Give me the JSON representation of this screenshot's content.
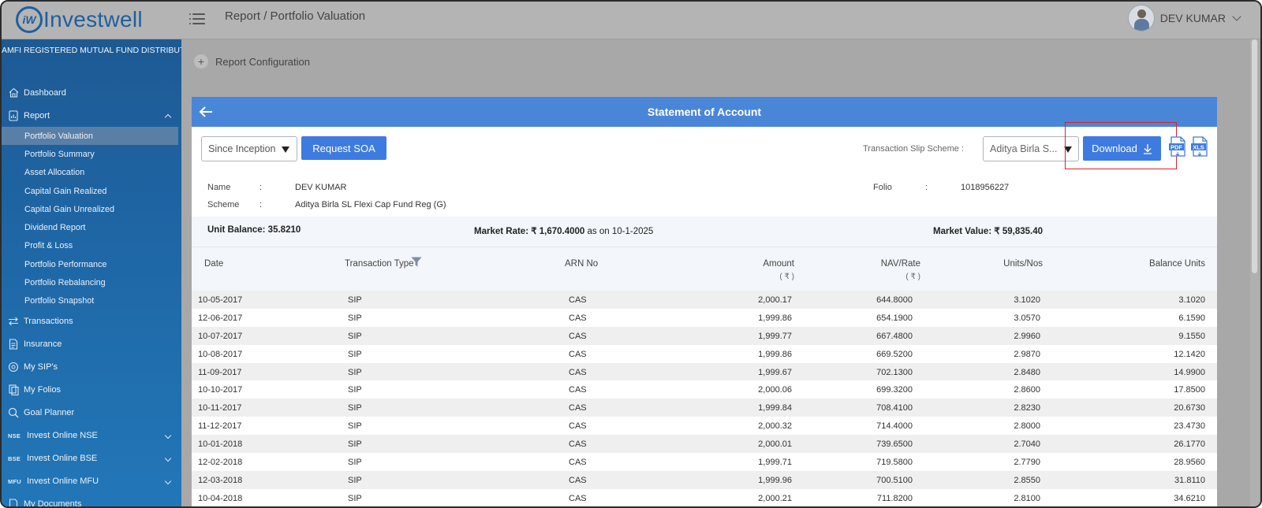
{
  "app": {
    "brand": "Investwell",
    "brand_mark": "iW"
  },
  "header": {
    "breadcrumb": "Report / Portfolio Valuation",
    "user_name": "DEV KUMAR"
  },
  "sidebar": {
    "tagline": "AMFI REGISTERED MUTUAL FUND DISTRIBUTOR",
    "items": [
      {
        "label": "Dashboard",
        "icon": "home-icon"
      },
      {
        "label": "Report",
        "icon": "report-icon",
        "expanded": true
      }
    ],
    "report_subitems": [
      "Portfolio Valuation",
      "Portfolio Summary",
      "Asset Allocation",
      "Capital Gain Realized",
      "Capital Gain Unrealized",
      "Dividend Report",
      "Profit & Loss",
      "Portfolio Performance",
      "Portfolio Rebalancing",
      "Portfolio Snapshot"
    ],
    "lower_items": [
      {
        "label": "Transactions",
        "icon": "transfer-icon"
      },
      {
        "label": "Insurance",
        "icon": "document-icon"
      },
      {
        "label": "My SIP's",
        "icon": "sip-icon"
      },
      {
        "label": "My Folios",
        "icon": "folio-icon"
      },
      {
        "label": "Goal Planner",
        "icon": "target-icon"
      },
      {
        "label": "Invest Online NSE",
        "tag": "NSE"
      },
      {
        "label": "Invest Online BSE",
        "tag": "BSE"
      },
      {
        "label": "Invest Online MFU",
        "tag": "MFU"
      },
      {
        "label": "My Documents",
        "icon": "documents-icon"
      }
    ],
    "active_item": "Portfolio Valuation"
  },
  "content": {
    "config_label": "Report Configuration"
  },
  "statement": {
    "title": "Statement of Account",
    "period_select": "Since Inception",
    "request_button": "Request SOA",
    "slip_label": "Transaction Slip Scheme :",
    "scheme_select": "Aditya Birla S...",
    "download_button": "Download",
    "pdf_label": "PDF",
    "xls_label": "XLS"
  },
  "investor": {
    "name_label": "Name",
    "name": "DEV KUMAR",
    "scheme_label": "Scheme",
    "scheme": "Aditya Birla SL Flexi Cap Fund Reg (G)",
    "folio_label": "Folio",
    "folio": "1018956227",
    "colon": ":",
    "unit_balance": "Unit Balance: 35.8210",
    "market_rate_label": "Market Rate:",
    "market_rate_value": "₹ 1,670.4000",
    "market_rate_suffix": "as on 10-1-2025",
    "market_value_label": "Market Value:",
    "market_value": "₹ 59,835.40"
  },
  "table": {
    "headers": [
      "Date",
      "Transaction Type",
      "ARN No",
      "Amount",
      "NAV/Rate",
      "Units/Nos",
      "Balance Units"
    ],
    "amount_unit": "( ₹ )",
    "nav_unit": "( ₹ )",
    "rows": [
      [
        "10-05-2017",
        "SIP",
        "CAS",
        "2,000.17",
        "644.8000",
        "3.1020",
        "3.1020"
      ],
      [
        "12-06-2017",
        "SIP",
        "CAS",
        "1,999.86",
        "654.1900",
        "3.0570",
        "6.1590"
      ],
      [
        "10-07-2017",
        "SIP",
        "CAS",
        "1,999.77",
        "667.4800",
        "2.9960",
        "9.1550"
      ],
      [
        "10-08-2017",
        "SIP",
        "CAS",
        "1,999.86",
        "669.5200",
        "2.9870",
        "12.1420"
      ],
      [
        "11-09-2017",
        "SIP",
        "CAS",
        "1,999.67",
        "702.1300",
        "2.8480",
        "14.9900"
      ],
      [
        "10-10-2017",
        "SIP",
        "CAS",
        "2,000.06",
        "699.3200",
        "2.8600",
        "17.8500"
      ],
      [
        "10-11-2017",
        "SIP",
        "CAS",
        "1,999.84",
        "708.4100",
        "2.8230",
        "20.6730"
      ],
      [
        "11-12-2017",
        "SIP",
        "CAS",
        "2,000.32",
        "714.4000",
        "2.8000",
        "23.4730"
      ],
      [
        "10-01-2018",
        "SIP",
        "CAS",
        "2,000.01",
        "739.6500",
        "2.7040",
        "26.1770"
      ],
      [
        "12-02-2018",
        "SIP",
        "CAS",
        "1,999.71",
        "719.5800",
        "2.7790",
        "28.9560"
      ],
      [
        "12-03-2018",
        "SIP",
        "CAS",
        "1,999.96",
        "700.5100",
        "2.8550",
        "31.8110"
      ],
      [
        "10-04-2018",
        "SIP",
        "CAS",
        "2,000.21",
        "711.8200",
        "2.8100",
        "34.6210"
      ]
    ]
  },
  "colors": {
    "accent": "#3e7be0",
    "header_blue": "#4a86d8",
    "sidebar": "#1f67a6",
    "highlight": "#e0202a"
  }
}
